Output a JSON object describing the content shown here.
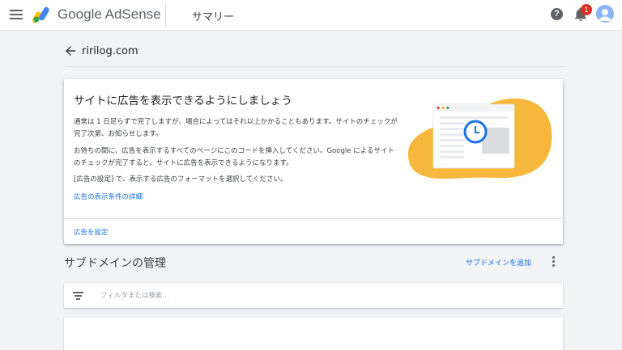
{
  "header": {
    "brand": "Google AdSense",
    "page": "サマリー",
    "help_symbol": "?",
    "notification_count": "1",
    "icons": [
      "menu-icon",
      "adsense-logo-icon",
      "help-icon",
      "bell-icon",
      "avatar"
    ]
  },
  "site": {
    "name": "ririlog.com",
    "back_icon": "arrow-back-icon"
  },
  "card": {
    "title": "サイトに広告を表示できるようにしましょう",
    "paragraph1": "通常は 1 日足らずで完了しますが、場合によってはそれ以上かかることもあります。サイトのチェックが完了次第、お知らせします。",
    "paragraph2": "お待ちの間に、広告を表示するすべてのページにこのコードを挿入してください。Google によるサイトのチェックが完了すると、サイトに広告を表示できるようになります。",
    "paragraph3": "[広告の設定] で、表示する広告のフォーマットを選択してください。",
    "link_detail": "広告の表示条件の詳細",
    "action_label": "広告を設定"
  },
  "subdomain": {
    "title": "サブドメインの管理",
    "add_label": "サブドメインを追加",
    "filter_placeholder": "フィルタまたは検索..."
  },
  "colors": {
    "accent": "#1a73e8",
    "illustration_blob": "#f6b73c",
    "badge": "#d93025",
    "clock": "#1a73e8"
  }
}
